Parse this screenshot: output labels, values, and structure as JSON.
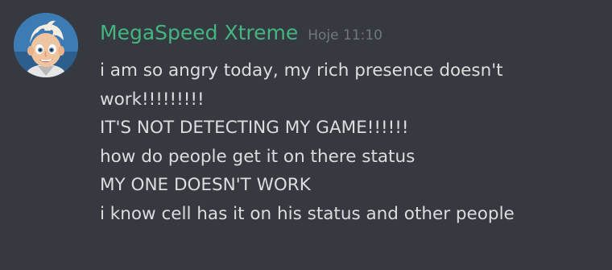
{
  "message": {
    "author": "MegaSpeed Xtreme",
    "timestamp": "Hoje 11:10",
    "avatar_icon": "cartoon-boy-avatar",
    "author_color": "#43b581",
    "lines": [
      "i am so angry today, my rich presence doesn't",
      "work!!!!!!!!!",
      "IT'S NOT DETECTING MY GAME!!!!!!",
      "how do people get it on there status",
      "MY ONE DOESN'T WORK",
      "i know cell has it on his status and other people"
    ]
  }
}
